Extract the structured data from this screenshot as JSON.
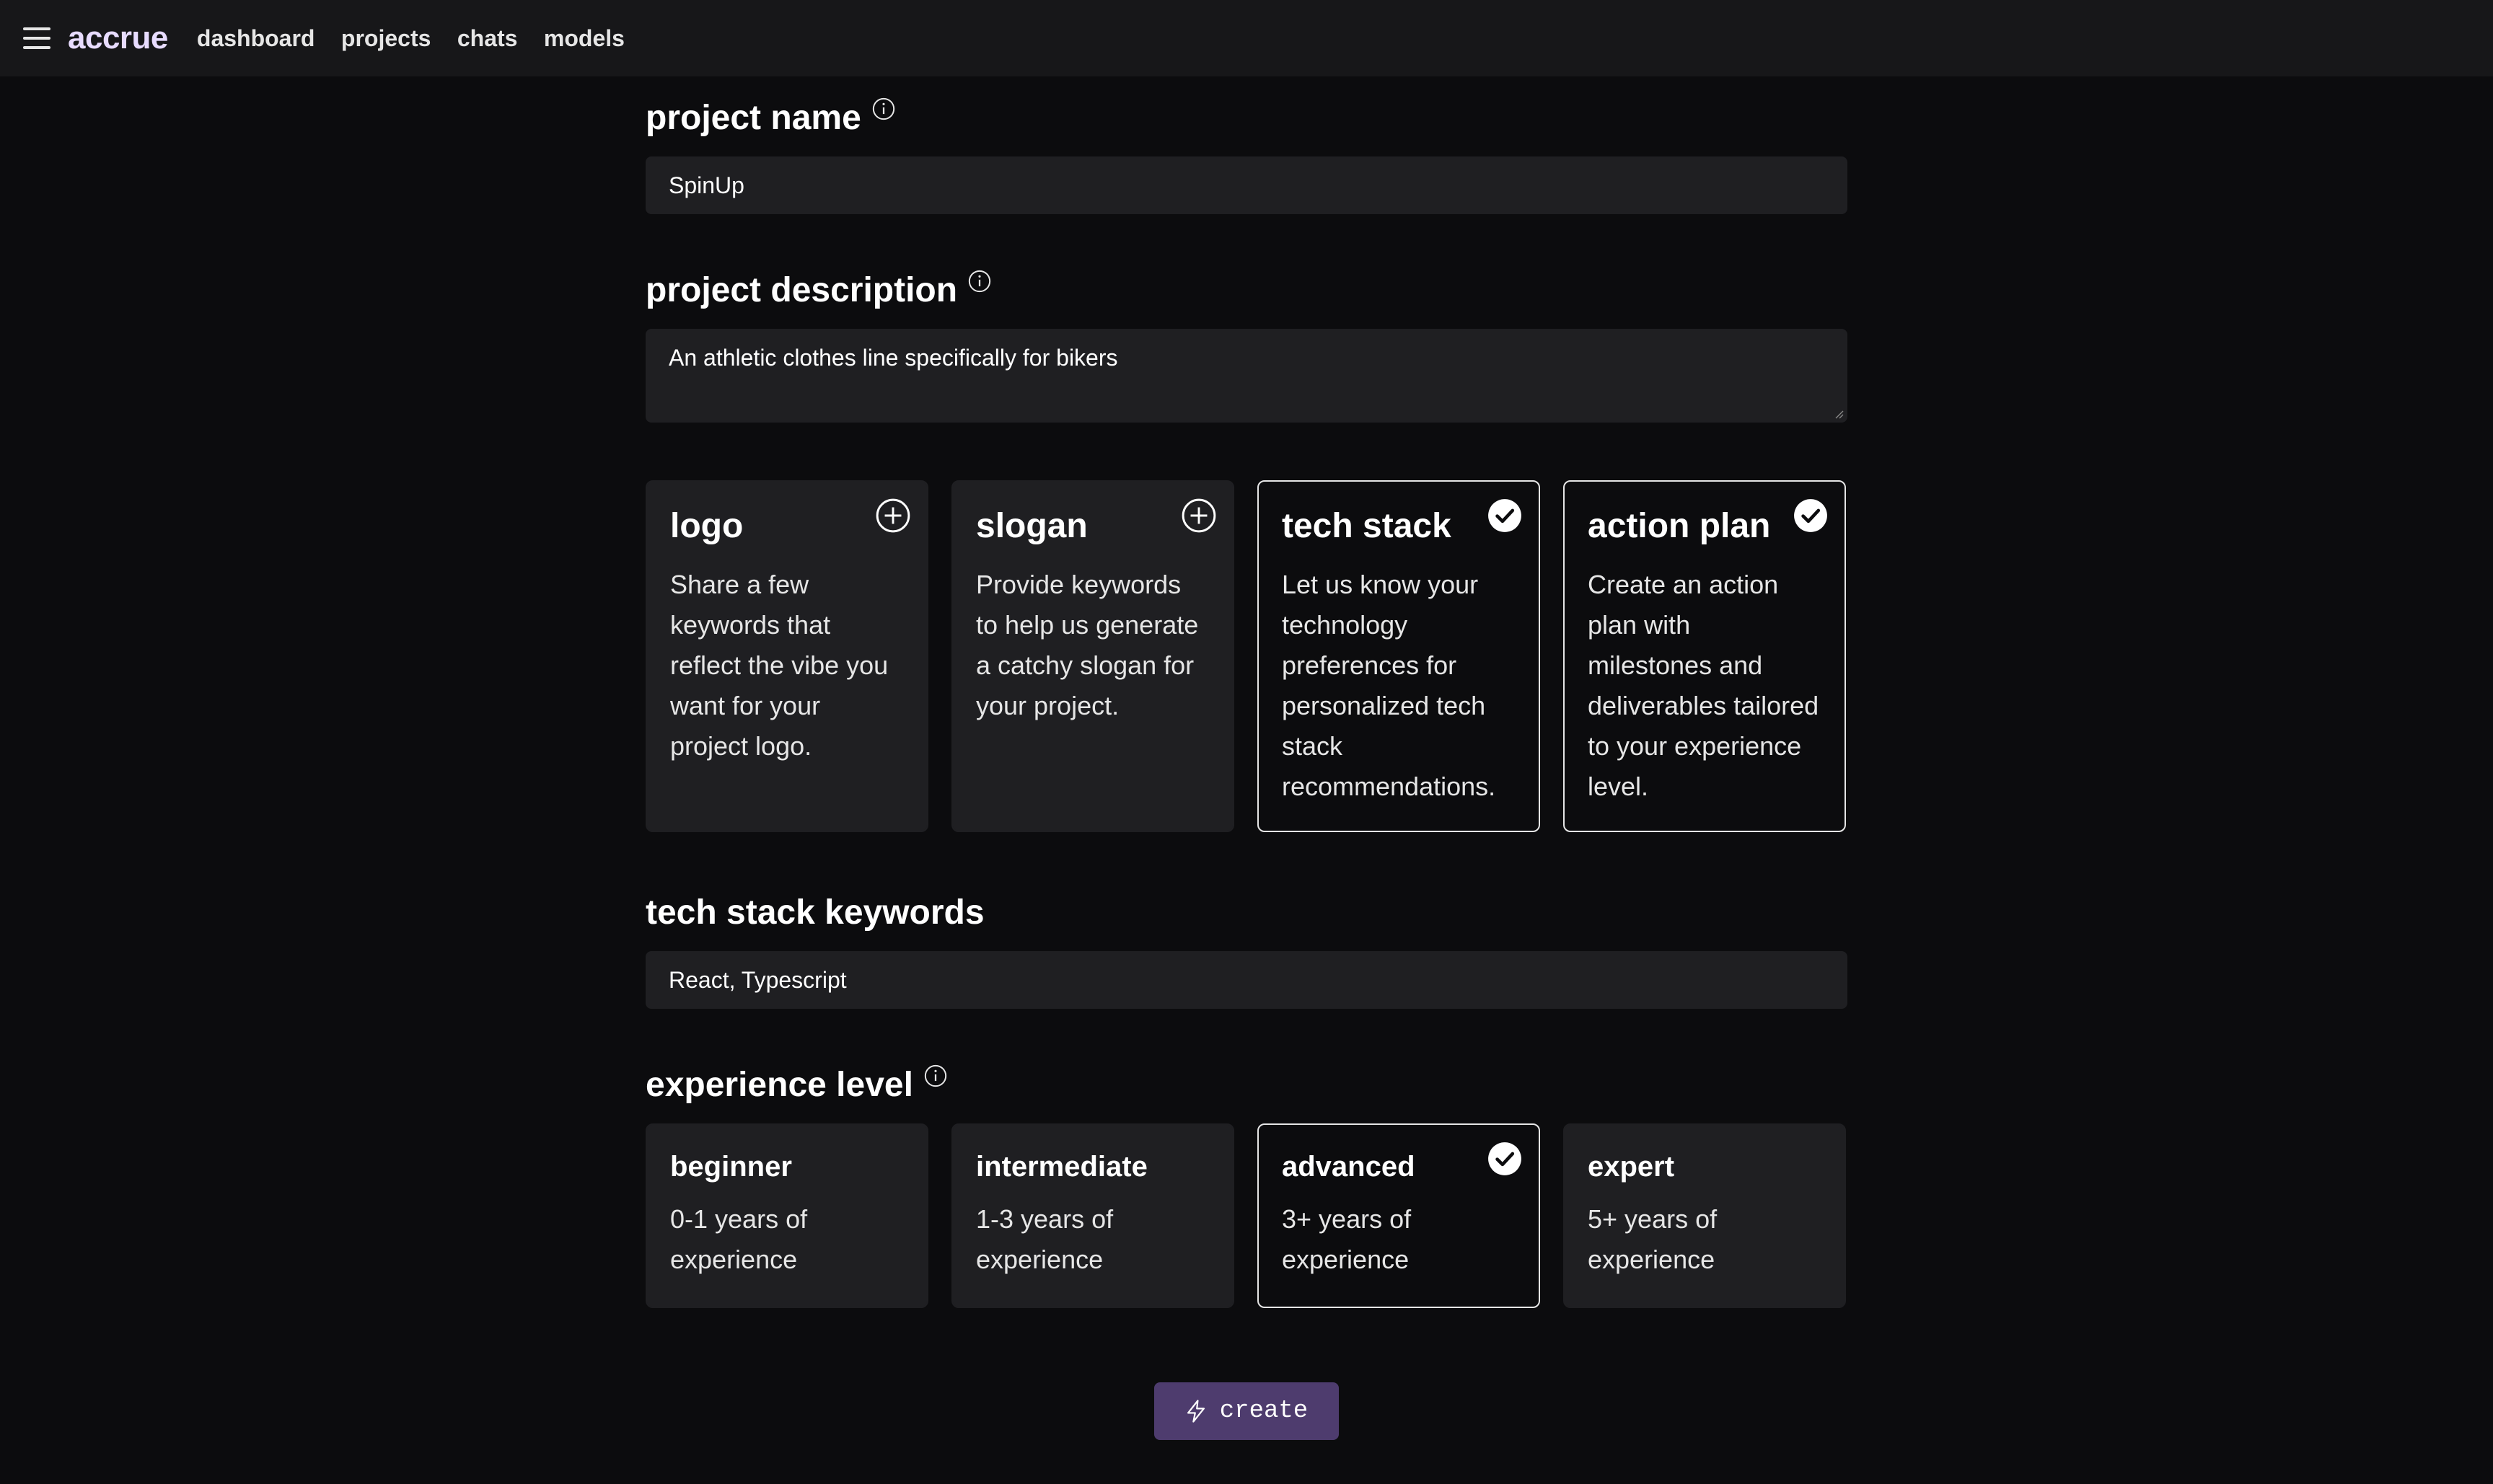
{
  "app": {
    "brand": "accrue"
  },
  "nav": {
    "items": [
      "dashboard",
      "projects",
      "chats",
      "models"
    ]
  },
  "project_name": {
    "label": "project name",
    "value": "SpinUp"
  },
  "project_description": {
    "label": "project description",
    "value": "An athletic clothes line specifically for bikers"
  },
  "features": [
    {
      "title": "logo",
      "desc": "Share a few keywords that reflect the vibe you want for your project logo.",
      "selected": false,
      "icon": "plus-circle-icon"
    },
    {
      "title": "slogan",
      "desc": "Provide keywords to help us generate a catchy slogan for your project.",
      "selected": false,
      "icon": "plus-circle-icon"
    },
    {
      "title": "tech stack",
      "desc": "Let us know your technology preferences for personalized tech stack recommendations.",
      "selected": true,
      "icon": "check-circle-icon"
    },
    {
      "title": "action plan",
      "desc": "Create an action plan with milestones and deliverables tailored to your experience level.",
      "selected": true,
      "icon": "check-circle-icon"
    }
  ],
  "tech_stack_keywords": {
    "label": "tech stack keywords",
    "value": "React, Typescript"
  },
  "experience": {
    "label": "experience level",
    "levels": [
      {
        "title": "beginner",
        "desc": "0-1 years of experience",
        "selected": false
      },
      {
        "title": "intermediate",
        "desc": "1-3 years of experience",
        "selected": false
      },
      {
        "title": "advanced",
        "desc": "3+ years of experience",
        "selected": true
      },
      {
        "title": "expert",
        "desc": "5+ years of experience",
        "selected": false
      }
    ]
  },
  "create_button": {
    "label": "create",
    "icon": "lightning-icon"
  },
  "colors": {
    "accent": "#4e3c6e",
    "brand": "#e8dcff",
    "background": "#0c0c0e",
    "surface": "#1f1f22"
  }
}
